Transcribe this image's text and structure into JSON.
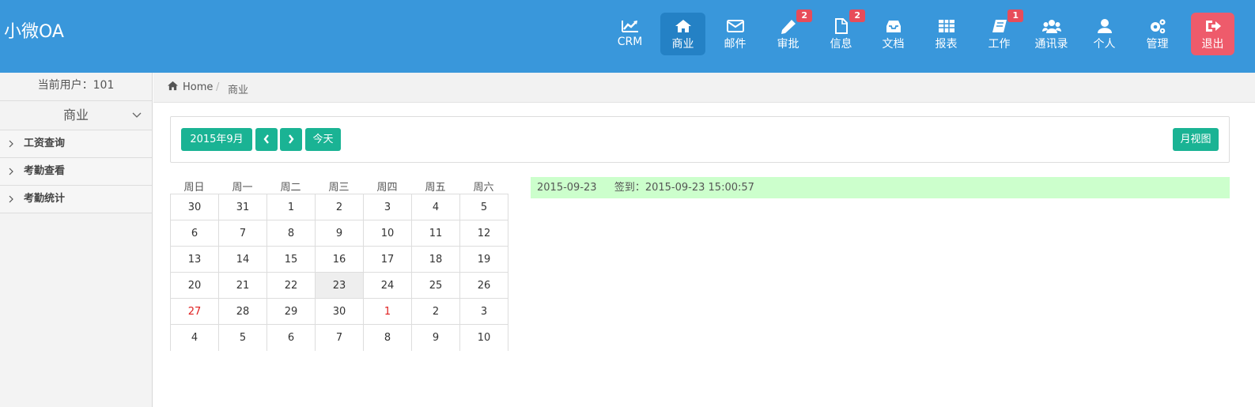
{
  "app": {
    "title": "小微OA"
  },
  "nav": [
    {
      "label": "CRM",
      "icon": "chart-line-icon",
      "badge": ""
    },
    {
      "label": "商业",
      "icon": "home-icon",
      "badge": ""
    },
    {
      "label": "邮件",
      "icon": "envelope-icon",
      "badge": ""
    },
    {
      "label": "审批",
      "icon": "pencil-icon",
      "badge": "2"
    },
    {
      "label": "信息",
      "icon": "file-icon",
      "badge": "2"
    },
    {
      "label": "文档",
      "icon": "inbox-icon",
      "badge": ""
    },
    {
      "label": "报表",
      "icon": "table-icon",
      "badge": ""
    },
    {
      "label": "工作",
      "icon": "book-icon",
      "badge": "1"
    },
    {
      "label": "通讯录",
      "icon": "users-icon",
      "badge": ""
    },
    {
      "label": "个人",
      "icon": "user-icon",
      "badge": ""
    },
    {
      "label": "管理",
      "icon": "gears-icon",
      "badge": ""
    },
    {
      "label": "退出",
      "icon": "sign-out-icon",
      "badge": ""
    }
  ],
  "colors": {
    "topbar": "#3997db",
    "accent": "#1ab394",
    "logout": "#ee5b6b",
    "event_bg": "#ccffcc",
    "badge": "#e74c5a"
  },
  "sidebar": {
    "user": "当前用户：101",
    "group": "商业",
    "items": [
      {
        "label": "工资查询"
      },
      {
        "label": "考勤查看"
      },
      {
        "label": "考勤统计"
      }
    ]
  },
  "breadcrumb": {
    "home": "Home",
    "separator": "/",
    "current": "商业"
  },
  "toolbar": {
    "month": "2015年9月",
    "today": "今天",
    "view": "月视图"
  },
  "calendar": {
    "weekdays": [
      "周日",
      "周一",
      "周二",
      "周三",
      "周四",
      "周五",
      "周六"
    ],
    "weeks": [
      [
        "30",
        "31",
        "1",
        "2",
        "3",
        "4",
        "5"
      ],
      [
        "6",
        "7",
        "8",
        "9",
        "10",
        "11",
        "12"
      ],
      [
        "13",
        "14",
        "15",
        "16",
        "17",
        "18",
        "19"
      ],
      [
        "20",
        "21",
        "22",
        "23",
        "24",
        "25",
        "26"
      ],
      [
        "27",
        "28",
        "29",
        "30",
        "1",
        "2",
        "3"
      ],
      [
        "4",
        "5",
        "6",
        "7",
        "8",
        "9",
        "10"
      ]
    ],
    "today": "23"
  },
  "event": {
    "date": "2015-09-23",
    "text": "签到：2015-09-23 15:00:57"
  }
}
